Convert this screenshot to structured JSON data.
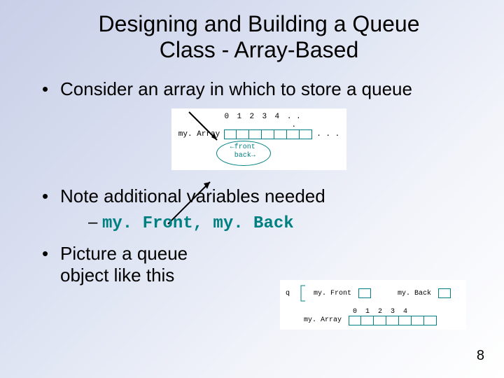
{
  "title_line1": "Designing and Building a Queue",
  "title_line2": "Class - Array-Based",
  "bullets": {
    "b1": "Consider an array in which to store a queue",
    "b2": "Note additional variables needed",
    "b2_sub": "my. Front, my. Back",
    "b3a": "Picture a queue",
    "b3b": "object like this"
  },
  "d1": {
    "label": "my. Array",
    "indices": [
      "0",
      "1",
      "2",
      "3",
      "4",
      ". . ."
    ],
    "front": "front",
    "back": "back",
    "dots": ". . ."
  },
  "d2": {
    "q": "q",
    "front_label": "my. Front",
    "back_label": "my. Back",
    "array_label": "my. Array",
    "indices": [
      "0",
      "1",
      "2",
      "3",
      "4"
    ]
  },
  "page": "8"
}
